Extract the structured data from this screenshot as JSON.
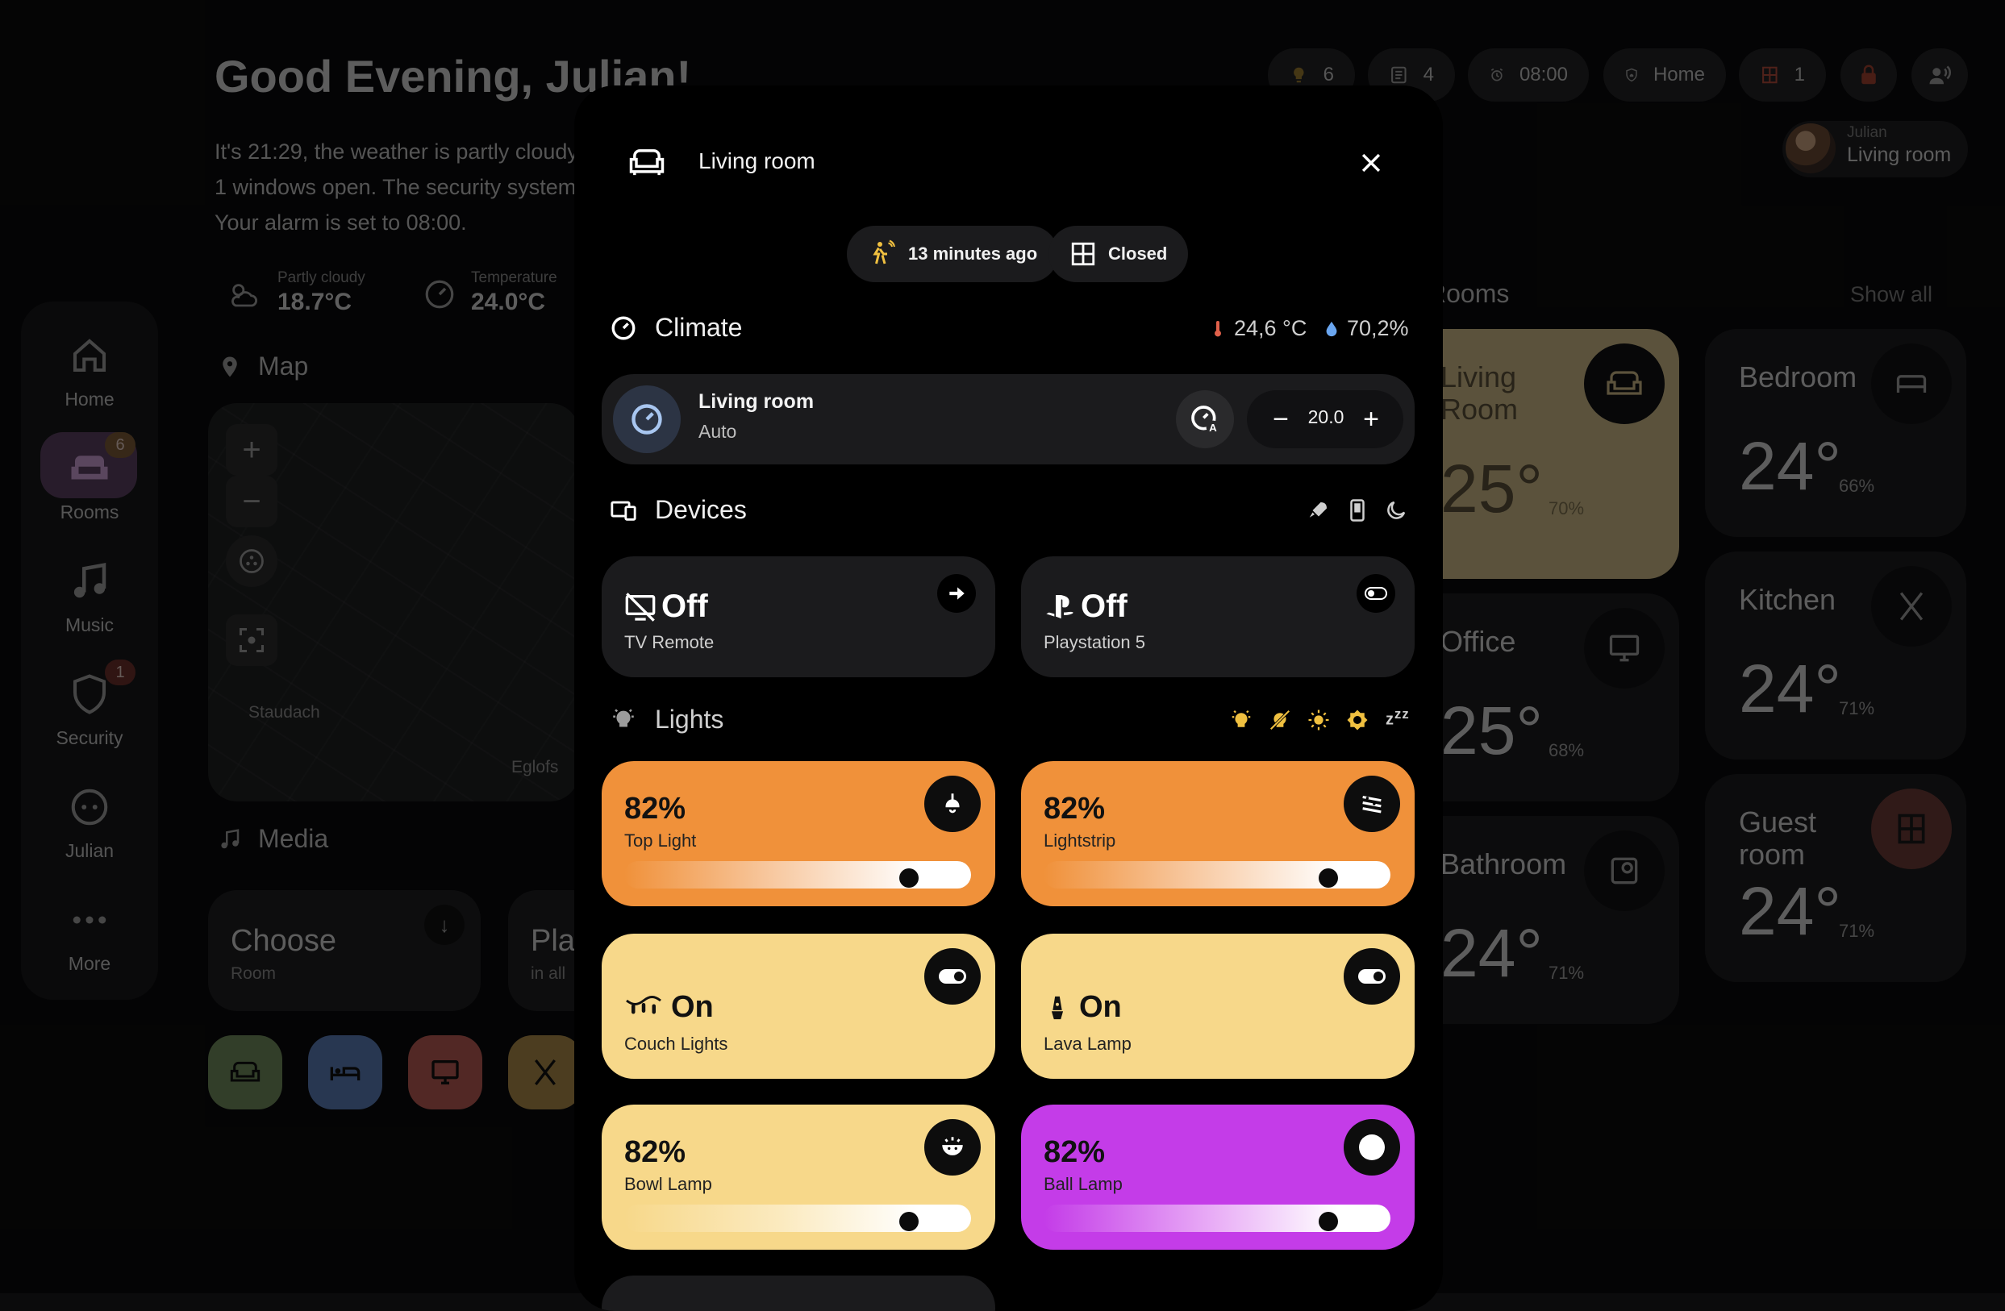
{
  "dashboard": {
    "greeting": "Good Evening, Julian!",
    "summary_lines": [
      "It's 21:29, the weather is partly cloudy",
      "1 windows open. The security system",
      "Your alarm is set to 08:00."
    ],
    "status_pills": [
      {
        "icon": "light-bulb-icon",
        "value": "6"
      },
      {
        "icon": "list-icon",
        "value": "4"
      },
      {
        "icon": "alarm-clock-icon",
        "value": "08:00"
      },
      {
        "icon": "shield-home-icon",
        "value": "Home"
      },
      {
        "icon": "window-icon",
        "value": "1"
      },
      {
        "icon": "lock-icon",
        "value": ""
      },
      {
        "icon": "voice-icon",
        "value": ""
      }
    ],
    "user": {
      "name": "Julian",
      "room": "Living room"
    },
    "weather": {
      "label": "Partly cloudy",
      "value": "18.7°C"
    },
    "temperature": {
      "label": "Temperature",
      "value": "24.0°C"
    },
    "map": {
      "title": "Map",
      "labels": [
        "Staudach",
        "Eglofs"
      ]
    },
    "media": {
      "title": "Media",
      "choose": "Choose",
      "choose_sub": "Room",
      "play": "Pla",
      "play_sub": "in all"
    },
    "rooms_section": {
      "title": "Rooms",
      "show_all": "Show all"
    },
    "sidebar": [
      {
        "label": "Home",
        "icon": "home-icon"
      },
      {
        "label": "Rooms",
        "icon": "sofa-icon",
        "badge": "6"
      },
      {
        "label": "Music",
        "icon": "music-note-icon"
      },
      {
        "label": "Security",
        "icon": "shield-icon",
        "badge": "1"
      },
      {
        "label": "Julian",
        "icon": "face-icon"
      },
      {
        "label": "More",
        "icon": "more-dots-icon"
      }
    ],
    "rooms": [
      {
        "name": "Living Room",
        "temp": "25°",
        "humidity": "70%"
      },
      {
        "name": "Bedroom",
        "temp": "24°",
        "humidity": "66%"
      },
      {
        "name": "Office",
        "temp": "25°",
        "humidity": "68%"
      },
      {
        "name": "Kitchen",
        "temp": "24°",
        "humidity": "71%"
      },
      {
        "name": "Bathroom",
        "temp": "24°",
        "humidity": "71%"
      },
      {
        "name": "Guest room",
        "temp": "24°",
        "humidity": "71%"
      }
    ]
  },
  "modal": {
    "title": "Living room",
    "chips": {
      "motion": "13 minutes ago",
      "window": "Closed"
    },
    "climate": {
      "title": "Climate",
      "temperature": "24,6 °C",
      "humidity": "70,2%",
      "thermostat_name": "Living room",
      "thermostat_mode": "Auto",
      "setpoint": "20.0"
    },
    "devices": {
      "title": "Devices",
      "items": [
        {
          "state": "Off",
          "name": "TV Remote",
          "icon": "tv-off-icon",
          "action_icon": "arrow-right-icon"
        },
        {
          "state": "Off",
          "name": "Playstation 5",
          "icon": "playstation-icon",
          "action_icon": "toggle-icon"
        }
      ]
    },
    "lights": {
      "title": "Lights",
      "items": [
        {
          "value": "82%",
          "name": "Top Light",
          "level": 0.82,
          "color": "#f0913a"
        },
        {
          "value": "82%",
          "name": "Lightstrip",
          "level": 0.82,
          "color": "#f0913a"
        },
        {
          "value": "On",
          "name": "Couch Lights",
          "color": "#f7d88a"
        },
        {
          "value": "On",
          "name": "Lava Lamp",
          "color": "#f7d88a"
        },
        {
          "value": "82%",
          "name": "Bowl Lamp",
          "level": 0.82,
          "color": "#f7d88a"
        },
        {
          "value": "82%",
          "name": "Ball Lamp",
          "level": 0.82,
          "color": "#c43ce8"
        }
      ]
    }
  }
}
